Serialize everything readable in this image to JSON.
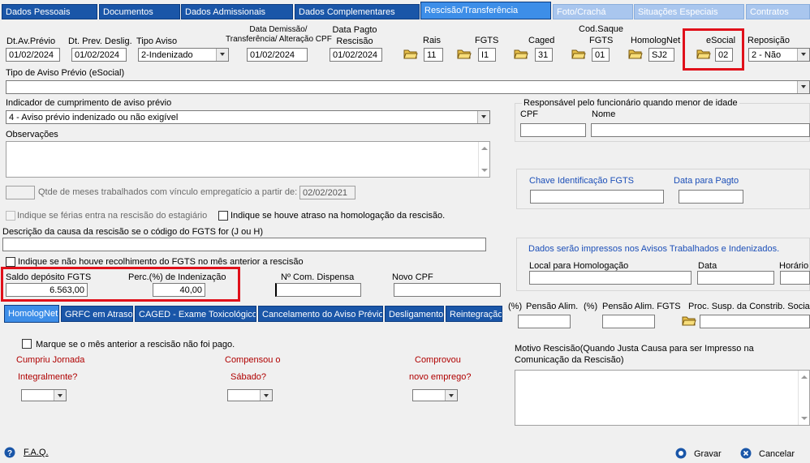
{
  "top_tabs": [
    {
      "label": "Dados Pessoais"
    },
    {
      "label": "Documentos"
    },
    {
      "label": "Dados Admissionais"
    },
    {
      "label": "Dados Complementares"
    },
    {
      "label": "Rescisão/Transferência"
    },
    {
      "label": "Foto/Crachá"
    },
    {
      "label": "Situações Especiais"
    },
    {
      "label": "Contratos"
    }
  ],
  "header": {
    "dt_av_previo": {
      "label": "Dt.Av.Prévio",
      "value": "01/02/2024"
    },
    "dt_prev_deslig": {
      "label": "Dt. Prev. Deslig.",
      "value": "01/02/2024"
    },
    "tipo_aviso": {
      "label": "Tipo Aviso",
      "value": "2-Indenizado"
    },
    "data_demissao": {
      "label_line1": "Data Demissão/",
      "label_line2": "Transferência/ Alteração CPF",
      "value": "01/02/2024"
    },
    "data_pagto": {
      "label_line1": "Data Pagto",
      "label_line2": "Rescisão",
      "value": "01/02/2024"
    },
    "rais": {
      "label": "Rais",
      "value": "11"
    },
    "fgts": {
      "label": "FGTS",
      "value": "I1"
    },
    "caged": {
      "label": "Caged",
      "value": "31"
    },
    "cod_saque": {
      "label_line1": "Cod.Saque",
      "label_line2": "FGTS",
      "value": "01"
    },
    "homolognet": {
      "label": "HomologNet",
      "value": "SJ2"
    },
    "esocial": {
      "label": "eSocial",
      "value": "02"
    },
    "reposicao": {
      "label": "Reposição",
      "value": "2 - Não"
    }
  },
  "tipo_aviso_esocial": {
    "label": "Tipo de Aviso Prévio (eSocial)",
    "value": ""
  },
  "indicador": {
    "label": "Indicador de cumprimento de aviso prévio",
    "value": "4 - Aviso prévio indenizado ou não exigível"
  },
  "observacoes": {
    "label": "Observações"
  },
  "responsavel": {
    "title": "Responsável pelo funcionário quando menor de idade",
    "cpf_label": "CPF",
    "nome_label": "Nome"
  },
  "qtde_meses": {
    "label": "Qtde de meses trabalhados com vínculo empregatício a partir de:",
    "value": "02/02/2021"
  },
  "fgts_box": {
    "chave_label": "Chave Identificação FGTS",
    "data_label": "Data para Pagto"
  },
  "checks": {
    "ferias_estagiario": "Indique se férias entra na rescisão do estagiário",
    "atraso_homologacao": "Indique se houve atraso na homologação da rescisão.",
    "sem_recolhimento": "Indique se não houve recolhimento do FGTS no mês anterior a rescisão"
  },
  "descricao_causa": {
    "label": "Descrição da causa da rescisão se o código do FGTS for (J ou H)"
  },
  "impressos": {
    "title": "Dados serão impressos nos Avisos Trabalhados e Indenizados.",
    "local_label": "Local para Homologação",
    "data_label": "Data",
    "horario_label": "Horário"
  },
  "saldo": {
    "saldo_label": "Saldo depósito FGTS",
    "saldo_value": "6.563,00",
    "perc_label": "Perc.(%)  de Indenização",
    "perc_value": "40,00"
  },
  "com_dispensa": {
    "label": "Nº Com. Dispensa",
    "value": ""
  },
  "novo_cpf": {
    "label": "Novo CPF",
    "value": ""
  },
  "bottom_tabs": [
    {
      "label": "HomologNet"
    },
    {
      "label": "GRFC em Atraso"
    },
    {
      "label": "CAGED - Exame Toxicológico"
    },
    {
      "label": "Cancelamento do Aviso Prévio"
    },
    {
      "label": "Desligamento"
    },
    {
      "label": "Reintegração"
    }
  ],
  "pensao": {
    "perc1": "(%)",
    "label1": "Pensão Alim.",
    "perc2": "(%)",
    "label2": "Pensão Alim. FGTS",
    "proc_label": "Proc. Susp. da Constrib. Social"
  },
  "homolognet_panel": {
    "check_label": "Marque se o mês anterior a rescisão não foi pago.",
    "q1_line1": "Cumpriu Jornada",
    "q1_line2": "Integralmente?",
    "q2_line1": "Compensou o",
    "q2_line2": "Sábado?",
    "q3_line1": "Comprovou",
    "q3_line2": "novo emprego?"
  },
  "motivo": {
    "line1": "Motivo Rescisão(Quando Justa Causa para ser Impresso na",
    "line2": "Comunicação da Rescisão)"
  },
  "footer": {
    "faq": "F.A.Q.",
    "gravar": "Gravar",
    "cancelar": "Cancelar"
  },
  "colors": {
    "tab_blue": "#1a56a8",
    "tab_active": "#3d8ee8",
    "highlight_red": "#e0101a",
    "label_red": "#b00000",
    "label_blue": "#1c4fb8"
  }
}
